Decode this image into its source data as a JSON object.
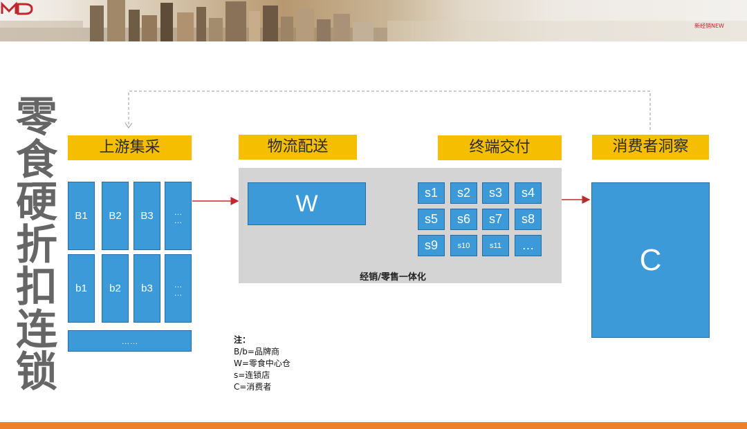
{
  "logo": {
    "text": "新经销NEW"
  },
  "title": "零食硬折扣连锁",
  "stages": {
    "upstream": "上游集采",
    "logistics": "物流配送",
    "terminal": "终端交付",
    "consumer": "消费者洞察"
  },
  "brands_upper": [
    "B1",
    "B2",
    "B3"
  ],
  "brands_lower": [
    "b1",
    "b2",
    "b3"
  ],
  "brand_more": [
    "…",
    "…"
  ],
  "brand_bottom": "……",
  "warehouse": "W",
  "stores": [
    "s1",
    "s2",
    "s3",
    "s4",
    "s5",
    "s6",
    "s7",
    "s8",
    "s9",
    "s10",
    "s11"
  ],
  "stores_more": "…",
  "panel_label": "经销/零售一体化",
  "consumer": "C",
  "note": {
    "head": "注：",
    "lines": [
      "B/b=品牌商",
      "W=零食中心仓",
      "s=连锁店",
      "C=消费者"
    ]
  },
  "colors": {
    "accent_yellow": "#f6be00",
    "block_blue": "#3d9ad9",
    "arrow_red": "#c0282d",
    "bottom_bar": "#f07f2a",
    "panel_grey": "#d5d4d4"
  }
}
